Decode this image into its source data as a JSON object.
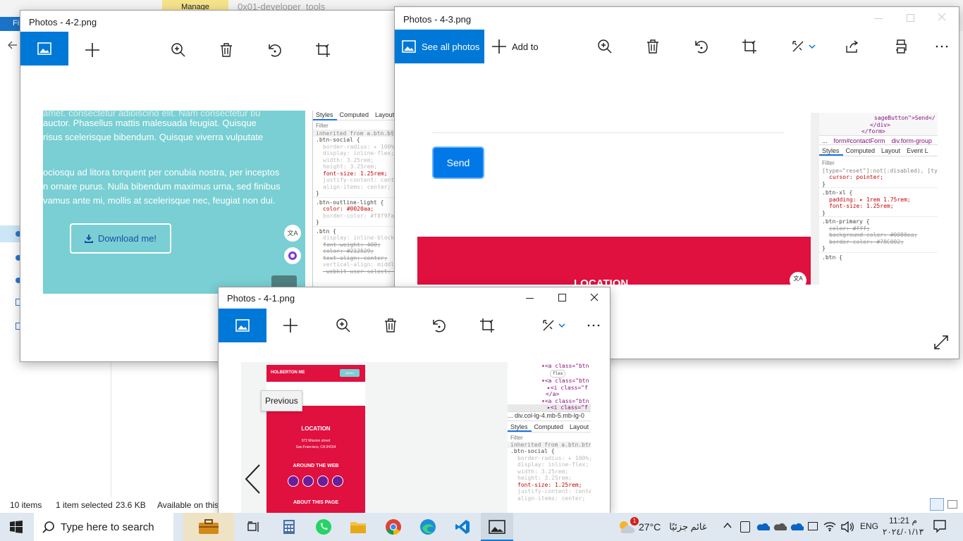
{
  "explorer": {
    "file_tab": "Fi",
    "manage_tab": "Manage",
    "path_text": "0x01-developer_tools",
    "status": {
      "item_count": "10 items",
      "selection": "1 item selected",
      "size": "23.6 KB",
      "availability": "Available on this"
    }
  },
  "window_4_2": {
    "title": "Photos - 4-2.png",
    "content": {
      "line1": "auctor. Phasellus mattis malesuada feugiat. Quisque",
      "line2": "risus scelerisque bibendum. Quisque viverra vulputate",
      "line3": "ociosqu ad litora torquent per conubia nostra, per inceptos",
      "line4": "n ornare purus. Nulla bibendum maximus urna, sed finibus",
      "line5": "vamus ante mi, mollis at scelerisque nec, feugiat non dui.",
      "download_label": "Download me!",
      "teal_color": "#79cfd3"
    },
    "devtools": {
      "tabs": [
        "Styles",
        "Computed",
        "Layout"
      ],
      "filter": "Filter",
      "inherited": "inherited from a.btn.btn-outl",
      "rules": [
        ".btn-social {",
        "border-radius: ▸ 100%;",
        "display: inline-flex;",
        "width: 3.25rem;",
        "height: 3.25rem;",
        "font-size: 1.25rem;",
        "justify-content: center;",
        "align-items: center;",
        "}",
        ".btn-outline-light {",
        "color: #0020aa;",
        "border-color: #f8f9fa;",
        "}",
        ".btn {",
        "display: inline-block;",
        "font-weight: 400;",
        "color: #212529;",
        "text-align: center;",
        "vertical-align: middle;",
        "-webkit-user-select: no"
      ]
    }
  },
  "window_4_3": {
    "title": "Photos - 4-3.png",
    "toolbar": {
      "see_all": "See all photos",
      "add_to": "Add to"
    },
    "content": {
      "send_label": "Send",
      "location_label": "LOCATION",
      "red_color": "#e0103f",
      "blue_color": "#0078e8"
    },
    "devtools": {
      "code": [
        "sageButton\">Send</",
        "</div>",
        "</form>"
      ],
      "breadcrumb": [
        "...",
        "form#contactForm",
        "div.form-group"
      ],
      "tabs": [
        "Styles",
        "Computed",
        "Layout",
        "Event L"
      ],
      "filter": "Filter",
      "rules": [
        "[type=\"reset\"]:not(:disabled), [ty",
        "cursor: pointer;",
        "}",
        ".btn-xl {",
        "padding: ▸ 1rem 1.75rem;",
        "font-size: 1.25rem;",
        "}",
        ".btn-primary {",
        "color: #fff;",
        "background-color: #0080ea;",
        "border-color: #78C002;",
        "}",
        ".btn {"
      ]
    }
  },
  "window_4_1": {
    "title": "Photos - 4-1.png",
    "tooltip": "Previous",
    "content": {
      "brand": "HOLBERTON ME",
      "menu": "MENU",
      "location": "LOCATION",
      "address1": "972 Mission street",
      "address2": "San Francisco, CA 94154",
      "around": "AROUND THE WEB",
      "about": "ABOUT THIS PAGE"
    },
    "devtools": {
      "code": [
        "▾<a class=\"btn",
        "flex",
        "▾<a class=\"btn",
        "▸<i class=\"f",
        "</a>",
        "▾<a class=\"btn",
        "▸<i class=\"f"
      ],
      "breadcrumb": "... div.col-lg-4.mb-5.mb-lg-0",
      "tabs": [
        "Styles",
        "Computed",
        "Layout"
      ],
      "filter": "Filter",
      "inherited": "inherited from a.btn.btn-outl",
      "rules": [
        ".btn-social {",
        "border-radius: ▸ 100%;",
        "display: inline-flex;",
        "width: 3.25rem;",
        "height: 3.25rem;",
        "font-size: 1.25rem;",
        "justify-content: cente",
        "align-items: center;"
      ]
    }
  },
  "taskbar": {
    "search_placeholder": "Type here to search",
    "weather_temp": "27°C",
    "weather_desc": "غائم جزئيًا",
    "language": "ENG",
    "time": "11:21 م",
    "date": "٢٠٢٤/٠١/١٣",
    "badge": "1"
  }
}
